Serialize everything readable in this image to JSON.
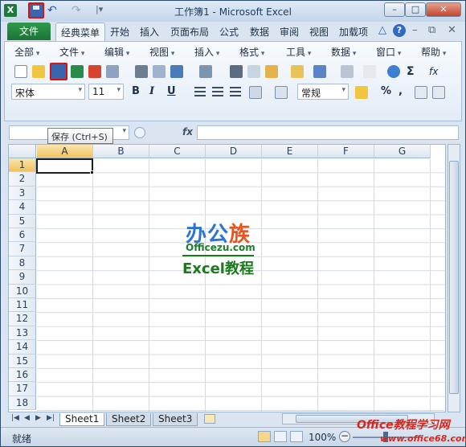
{
  "window": {
    "title": "工作簿1 - Microsoft Excel",
    "min": "–",
    "max": "□",
    "close": "✕"
  },
  "quick_access": {
    "app_icon": "X",
    "undo": "↶",
    "redo": "↷",
    "customize": "|▾"
  },
  "tabs": {
    "file": "文件",
    "items": [
      "经典菜单",
      "开始",
      "插入",
      "页面布局",
      "公式",
      "数据",
      "审阅",
      "视图",
      "加载项"
    ],
    "active": "经典菜单"
  },
  "ribbon_right": {
    "minimize": "△",
    "help": "?",
    "restore": "⧉",
    "win_min": "–",
    "win_close": "✕"
  },
  "menu": [
    "全部",
    "文件",
    "编辑",
    "视图",
    "插入",
    "格式",
    "工具",
    "数据",
    "窗口",
    "帮助"
  ],
  "format": {
    "font": "宋体",
    "size": "11",
    "bold": "B",
    "italic": "I",
    "underline": "U",
    "number_format": "常规",
    "percent": "%",
    "comma": ","
  },
  "formula_bar": {
    "fx": "fx",
    "tooltip": "保存 (Ctrl+S)"
  },
  "columns": [
    "A",
    "B",
    "C",
    "D",
    "E",
    "F",
    "G"
  ],
  "rows": [
    "1",
    "2",
    "3",
    "4",
    "5",
    "6",
    "7",
    "8",
    "9",
    "10",
    "11",
    "12",
    "13",
    "14",
    "15",
    "16",
    "17",
    "18"
  ],
  "active_cell": "A1",
  "watermark": {
    "logo_main": "办公",
    "logo_accent": "族",
    "site": "Officezu.com",
    "course": "Excel教程"
  },
  "sheets": [
    "Sheet1",
    "Sheet2",
    "Sheet3"
  ],
  "active_sheet": "Sheet1",
  "status": {
    "text": "就绪",
    "zoom": "100%",
    "zoom_level_percent": 100
  },
  "footer_brand": {
    "line1": "Office教程学习网",
    "line2": "www.office68.com"
  },
  "colors": {
    "file_tab": "#1c7335",
    "accent": "#2b74d6",
    "highlight_red": "#e01010"
  }
}
